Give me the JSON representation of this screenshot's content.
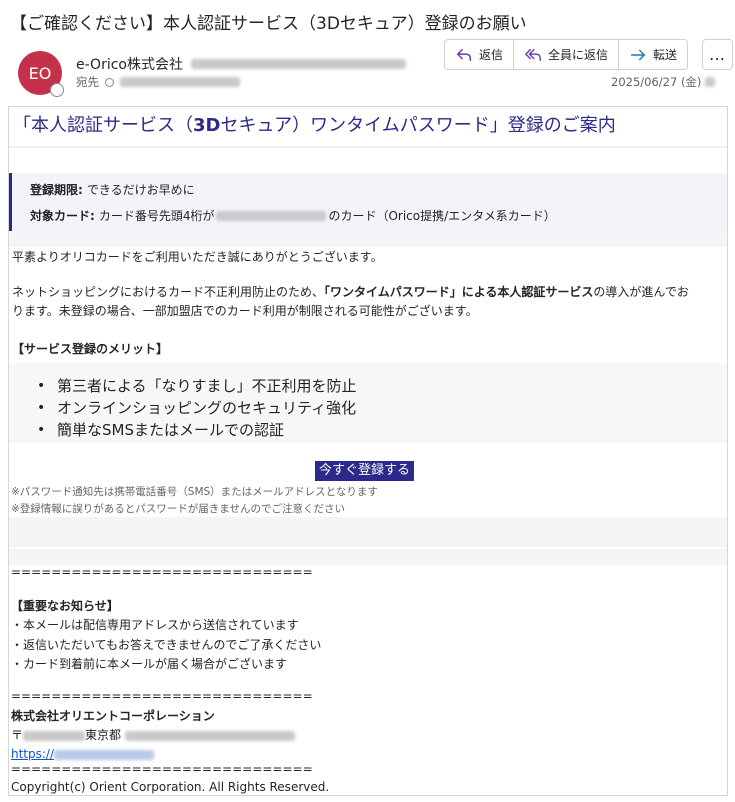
{
  "subject": "【ご確認ください】本人認証サービス（3Dセキュア）登録のお願い",
  "avatar_initials": "EO",
  "sender_name": "e-Orico株式会社",
  "to_label": "宛先",
  "date": "2025/06/27 (金)",
  "actions": {
    "reply": "返信",
    "reply_all": "全員に返信",
    "forward": "転送",
    "more": "…"
  },
  "mail": {
    "heading_pre": "「本人認証サービス（",
    "heading_bold": "3D",
    "heading_post": "セキュア）ワンタイムパスワード」登録のご案内",
    "deadline_label": "登録期限:",
    "deadline_value": "できるだけお早めに",
    "card_label": "対象カード:",
    "card_value_pre": "カード番号先頭4桁が",
    "card_value_post": "のカード（Orico提携/エンタメ系カード）",
    "greeting": "平素よりオリコカードをご利用いただき誠にありがとうございます。",
    "body_pre": "ネットショッピングにおけるカード不正利用防止のため、",
    "body_bold": "「ワンタイムパスワード」による本人認証サービス",
    "body_line1_post": "の導入が進んでお",
    "body_line2": "ります。未登録の場合、一部加盟店でのカード利用が制限される可能性がございます。",
    "merit_title": "【サービス登録のメリット】",
    "merits": [
      "第三者による「なりすまし」不正利用を防止",
      "オンラインショッピングのセキュリティ強化",
      "簡単なSMSまたはメールでの認証"
    ],
    "cta": "今すぐ登録する",
    "note1": "※パスワード通知先は携帯電話番号（SMS）またはメールアドレスとなります",
    "note2": "※登録情報に誤りがあるとパスワードが届きませんのでご注意ください",
    "divider": "==============================",
    "notice_title": "【重要なお知らせ】",
    "notices": [
      "・本メールは配信専用アドレスから送信されています",
      "・返信いただいてもお答えできませんのでご了承ください",
      "・カード到着前に本メールが届く場合がございます"
    ],
    "company": "株式会社オリエントコーポレーション",
    "address_pre": "〒",
    "address_city": "東京都",
    "url_prefix": "https://",
    "copyright": "Copyright(c) Orient Corporation. All Rights Reserved."
  }
}
